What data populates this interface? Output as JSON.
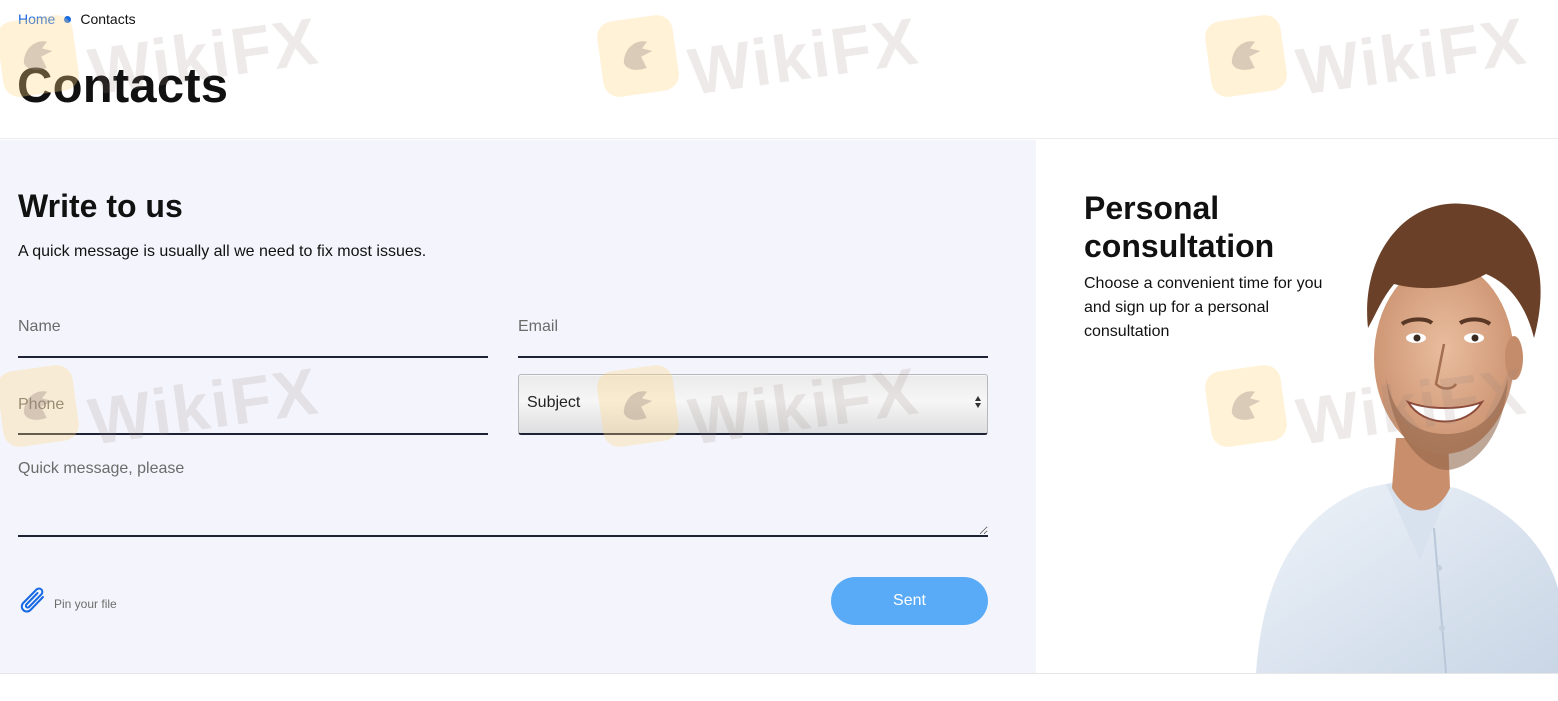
{
  "breadcrumb": {
    "home": "Home",
    "current": "Contacts"
  },
  "page_title": "Contacts",
  "form": {
    "title": "Write to us",
    "subtitle": "A quick message is usually all we need to fix most issues.",
    "name_placeholder": "Name",
    "email_placeholder": "Email",
    "phone_placeholder": "Phone",
    "subject_value": "Subject",
    "message_placeholder": "Quick message, please",
    "attach_label": "Pin your file",
    "send_label": "Sent"
  },
  "consultation": {
    "title": "Personal consultation",
    "text": "Choose a convenient time for you and sign up for a personal consultation"
  },
  "watermark": {
    "text": "WikiFX"
  },
  "icons": {
    "attach": "paperclip-icon",
    "select": "select-arrows-icon",
    "watermark_logo": "wikifx-logo-icon"
  },
  "colors": {
    "link": "#1668e3",
    "button": "#5aabf7",
    "panel": "#f4f5fc",
    "field_line": "#1e2235"
  }
}
